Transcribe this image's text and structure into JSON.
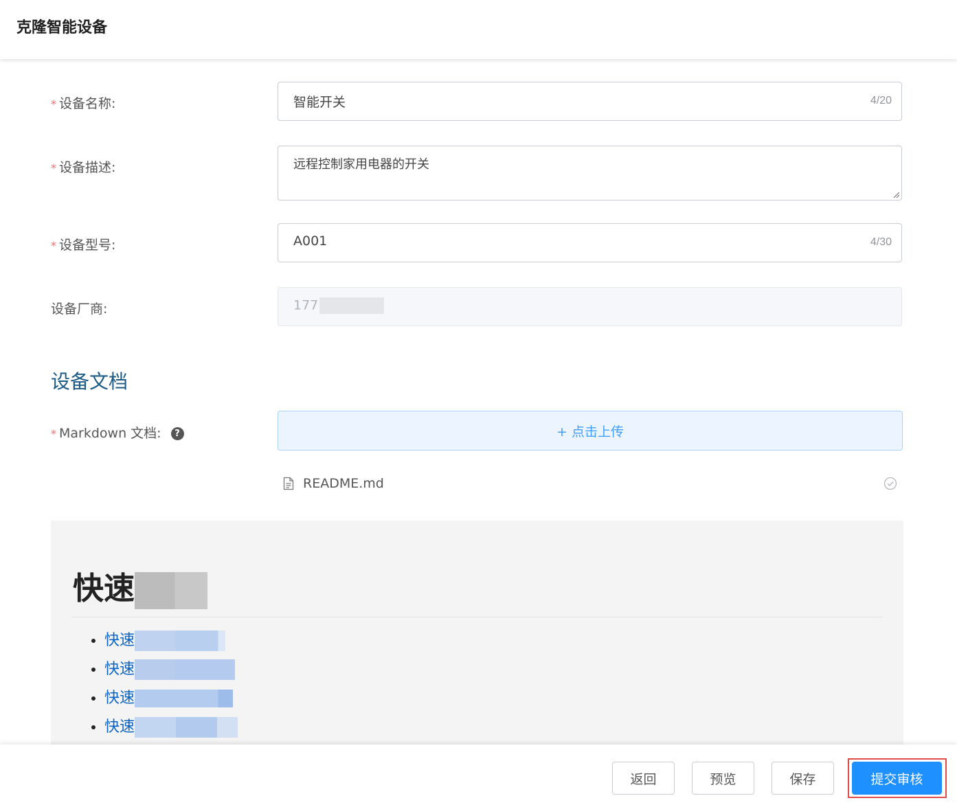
{
  "header": {
    "title": "克隆智能设备"
  },
  "form": {
    "name": {
      "required_mark": "*",
      "label": "设备名称:",
      "value": "智能开关",
      "count": "4/20"
    },
    "description": {
      "required_mark": "*",
      "label": "设备描述:",
      "value": "远程控制家用电器的开关"
    },
    "model": {
      "required_mark": "*",
      "label": "设备型号:",
      "value": "A001",
      "count": "4/30"
    },
    "vendor": {
      "label": "设备厂商:",
      "value": "177"
    }
  },
  "docs": {
    "section_title": "设备文档",
    "markdown": {
      "required_mark": "*",
      "label": "Markdown 文档:",
      "help_glyph": "?"
    },
    "upload_label": "+ 点击上传",
    "file": {
      "name": "README.md"
    }
  },
  "preview": {
    "heading": "快速",
    "items": [
      {
        "text": "快速"
      },
      {
        "text": "快速"
      },
      {
        "text": "快速"
      },
      {
        "text": "快速"
      }
    ]
  },
  "footer": {
    "back_label": "返回",
    "preview_label": "预览",
    "save_label": "保存",
    "submit_label": "提交审核"
  },
  "colors": {
    "primary": "#1e90ff",
    "required": "#f56c6c",
    "link": "#0b63c5",
    "section_title": "#1b5a85"
  }
}
